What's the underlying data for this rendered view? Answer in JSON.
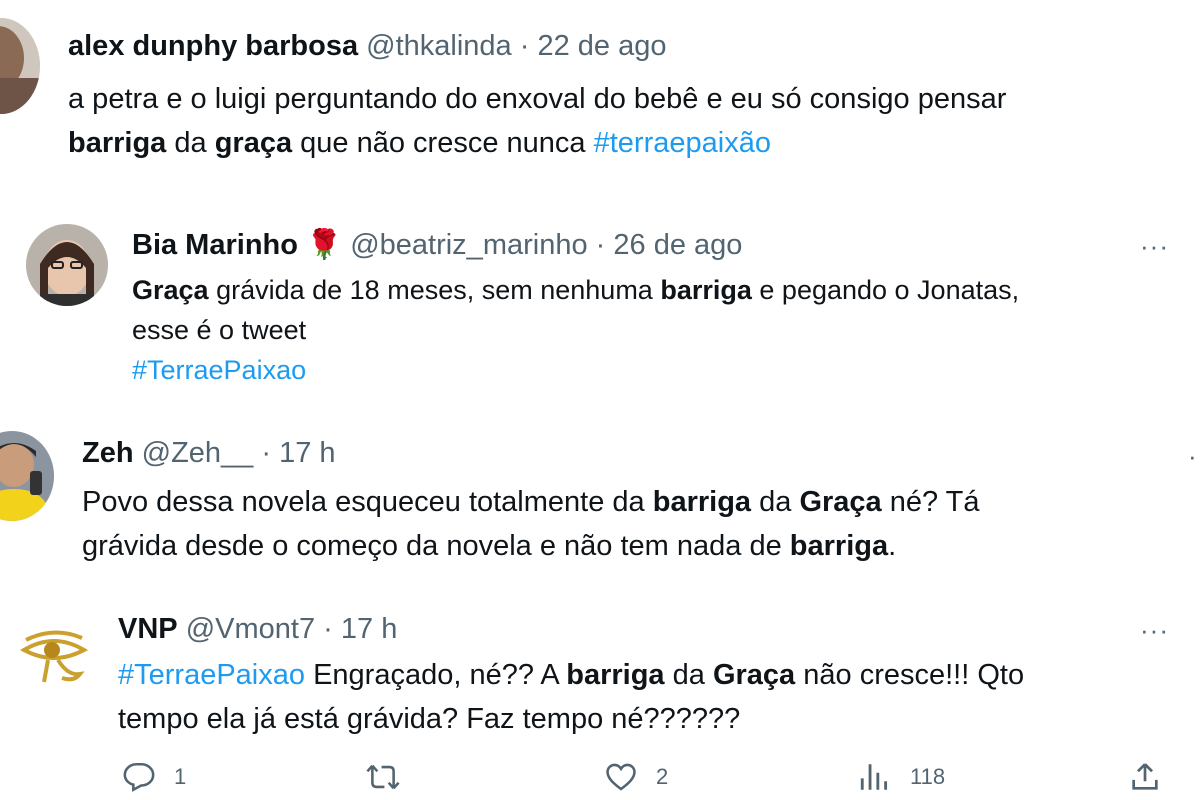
{
  "tweets": [
    {
      "name": "alex dunphy barbosa",
      "handle": "@thkalinda",
      "sep": "·",
      "date": "22 de ago",
      "line1": "a petra e o luigi perguntando do enxoval do bebê e eu só consigo pensar",
      "line2_bold1": "barriga",
      "line2_text1": "da",
      "line2_bold2": "graça",
      "line2_text2": "que não cresce nunca",
      "line2_hashtag": "#terraepaixão"
    },
    {
      "name": "Bia Marinho",
      "emoji": "🌹",
      "handle": "@beatriz_marinho",
      "sep": "·",
      "date": "26 de ago",
      "line1_bold1": "Graça",
      "line1_text1": "grávida de 18 meses, sem nenhuma",
      "line1_bold2": "barriga",
      "line1_text2": "e pegando o Jonatas,",
      "line2": "esse é o tweet",
      "line3_hashtag": "#TerraePaixao",
      "more": "···"
    },
    {
      "name": "Zeh",
      "handle": "@Zeh__",
      "sep": "·",
      "date": "17 h",
      "line1_text1": "Povo dessa novela esqueceu totalmente da",
      "line1_bold1": "barriga",
      "line1_text2": "da",
      "line1_bold2": "Graça",
      "line1_text3": "né? Tá",
      "line2_text1": "grávida desde o começo da novela e não tem nada de",
      "line2_bold1": "barriga",
      "line2_text2": "."
    },
    {
      "name": "VNP",
      "handle": "@Vmont7",
      "sep": "·",
      "date": "17 h",
      "line1_hashtag": "#TerraePaixao",
      "line1_text1": "Engraçado, né?? A",
      "line1_bold1": "barriga",
      "line1_text2": "da",
      "line1_bold2": "Graça",
      "line1_text3": "não cresce!!! Qto",
      "line2": "tempo ela já está grávida? Faz tempo né??????",
      "more": "···"
    }
  ],
  "actions": {
    "reply_count": "1",
    "retweet_count": "",
    "like_count": "2",
    "views_count": "118"
  },
  "colors": {
    "hashtag": "#1d9bf0",
    "muted": "#536471",
    "text": "#0f1419"
  }
}
